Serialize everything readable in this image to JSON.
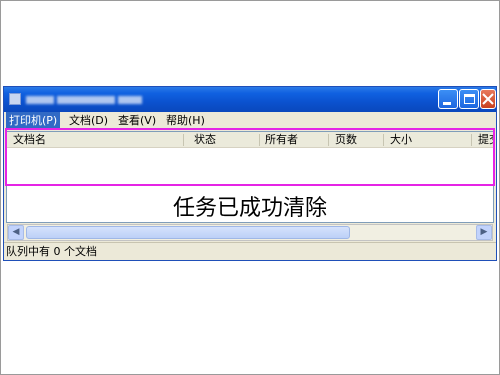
{
  "window": {
    "title_obscured": true,
    "controls": [
      "minimize-icon",
      "maximize-icon",
      "close-icon"
    ]
  },
  "menubar": {
    "printer": "打印机(P)",
    "document": "文档(D)",
    "view": "查看(V)",
    "help": "帮助(H)"
  },
  "table": {
    "columns": [
      "文档名",
      "状态",
      "所有者",
      "页数",
      "大小",
      "提交"
    ],
    "rows": []
  },
  "caption": "任务已成功清除",
  "status": {
    "text": "队列中有 0 个文档"
  },
  "colors": {
    "titlebar": "#0a54d6",
    "highlight": "#e524e5",
    "menu_active": "#316ac5"
  }
}
